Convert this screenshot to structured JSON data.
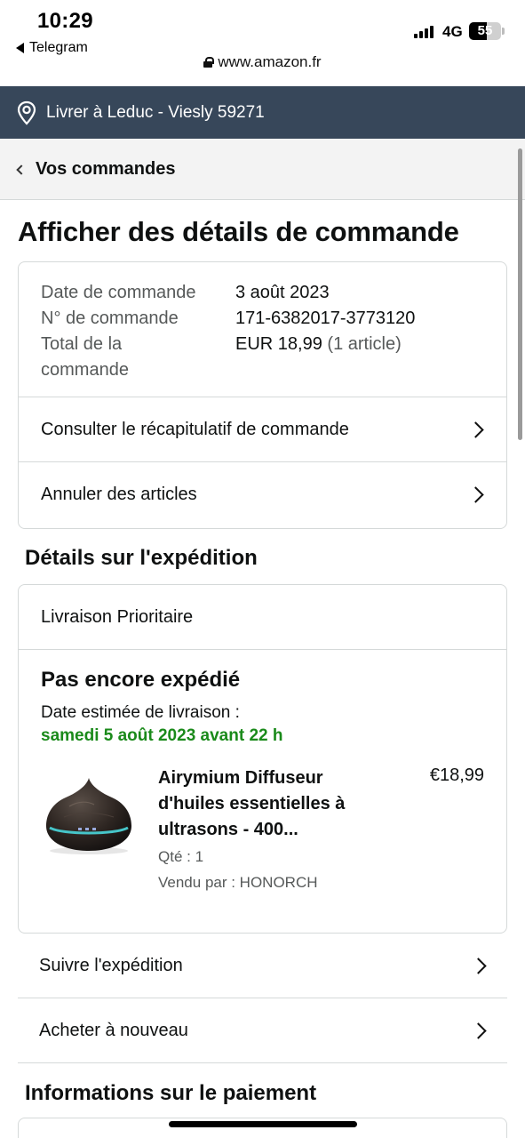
{
  "status_bar": {
    "time": "10:29",
    "back_app": "Telegram",
    "url": "www.amazon.fr",
    "network": "4G",
    "battery": "55",
    "battery_level": 0.55
  },
  "location": {
    "label": "Livrer à Leduc - Viesly 59271"
  },
  "breadcrumb": {
    "label": "Vos commandes"
  },
  "page_title": "Afficher des détails de commande",
  "order_summary": {
    "rows": [
      {
        "key": "Date de commande",
        "value": "3 août 2023",
        "extra": ""
      },
      {
        "key": "N° de commande",
        "value": "171-6382017-3773120",
        "extra": ""
      },
      {
        "key": "Total de la commande",
        "value": "EUR 18,99",
        "extra": "(1 article)"
      }
    ],
    "links": [
      {
        "label": "Consulter le récapitulatif de commande"
      },
      {
        "label": "Annuler des articles"
      }
    ]
  },
  "shipping": {
    "section_title": "Détails sur l'expédition",
    "method": "Livraison Prioritaire",
    "status": "Pas encore expédié",
    "estimate_label": "Date estimée de livraison :",
    "estimate_date": "samedi 5 août 2023 avant 22 h",
    "product": {
      "name": "Airymium Diffuseur d'huiles essentielles à ultrasons - 400...",
      "price": "€18,99",
      "qty": "Qté : 1",
      "seller": "Vendu par : HONORCH"
    },
    "links": [
      {
        "label": "Suivre l'expédition"
      },
      {
        "label": "Acheter à nouveau"
      }
    ]
  },
  "payment": {
    "section_title": "Informations sur le paiement"
  },
  "colors": {
    "location_bar": "#37475a",
    "delivery_green": "#1a8a1a",
    "border": "#d5d9d9"
  }
}
